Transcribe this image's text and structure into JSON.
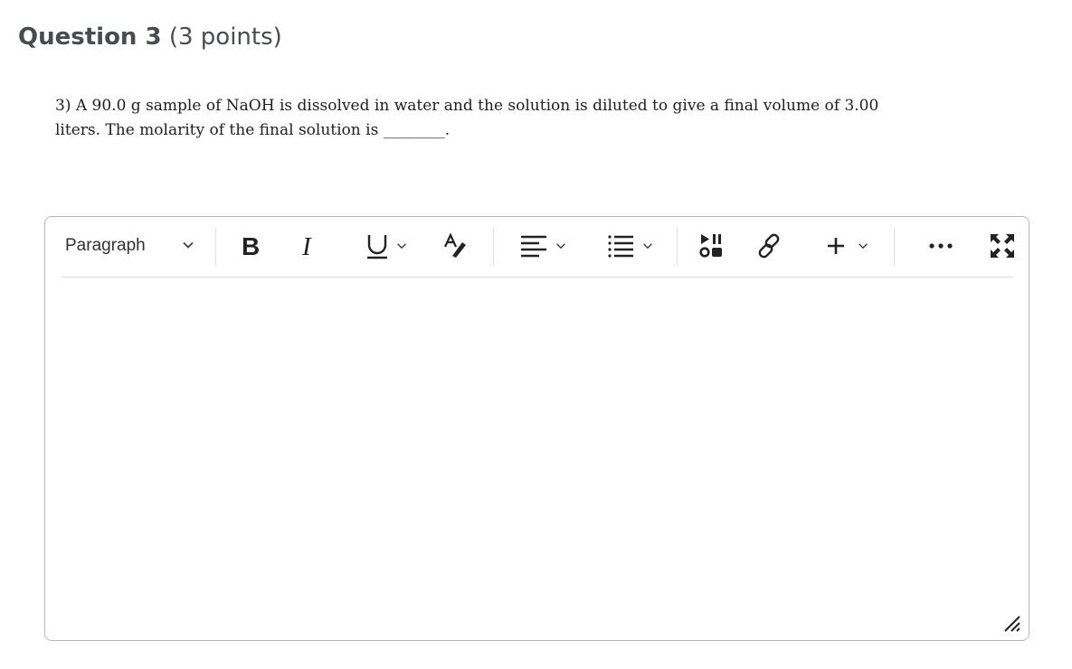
{
  "question": {
    "title": "Question 3",
    "points": "(3 points)",
    "text": "3) A 90.0 g sample of NaOH is dissolved in water and the solution is diluted to give a final volume of 3.00 liters. The molarity of the final solution is ________."
  },
  "editor": {
    "format_select_value": "Paragraph",
    "content": "",
    "toolbar_icons": [
      "chevron-down-icon",
      "bold-icon",
      "italic-icon",
      "underline-icon",
      "text-color-icon",
      "align-left-icon",
      "bulleted-list-icon",
      "insert-media-icon",
      "link-icon",
      "plus-icon",
      "more-icon",
      "fullscreen-icon",
      "resize-handle-icon"
    ]
  }
}
